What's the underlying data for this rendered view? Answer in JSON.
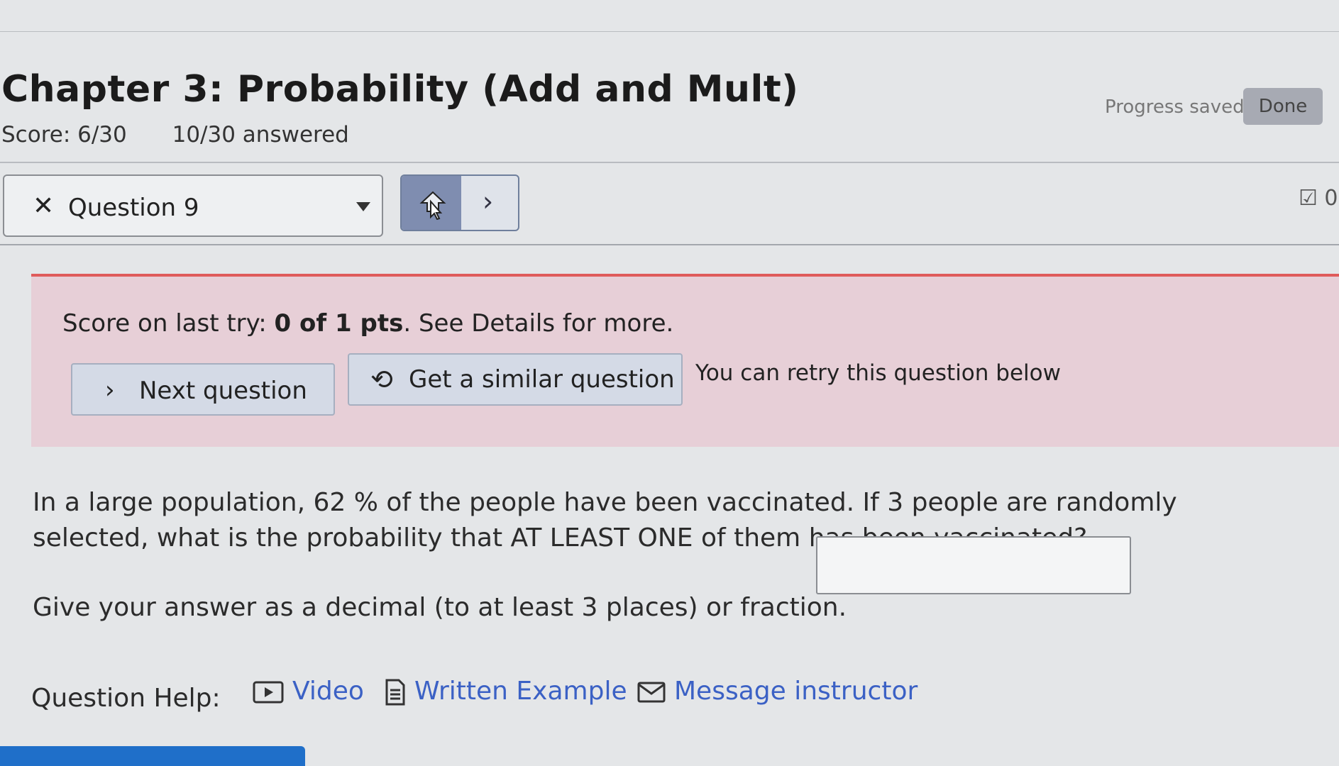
{
  "header": {
    "title": "Chapter 3: Probability (Add and Mult)",
    "score": "Score: 6/30",
    "answered": "10/30 answered",
    "progress_status": "Progress saved",
    "done_label": "Done"
  },
  "question_nav": {
    "current_question": "Question 9",
    "close_glyph": "✕",
    "next_glyph": "›",
    "side_icon_text": "☑ 0"
  },
  "banner": {
    "score_prefix": "Score on last try: ",
    "score_value": "0 of 1 pts",
    "score_suffix": ". See Details for more.",
    "next_question_label": "Next question",
    "similar_question_label": "Get a similar question",
    "retry_text": "You can retry this question below",
    "accent_color": "#df5b5b"
  },
  "question": {
    "text": "In a large population, 62 % of the people have been vaccinated. If 3 people are randomly selected, what is the probability that AT LEAST ONE of them has been vaccinated?",
    "instructions": "Give your answer as a decimal (to at least 3 places) or fraction.",
    "answer_value": ""
  },
  "help": {
    "label": "Question Help:",
    "video_label": "Video",
    "written_example_label": "Written Example",
    "message_label": "Message instructor",
    "link_color": "#3b61c5"
  }
}
